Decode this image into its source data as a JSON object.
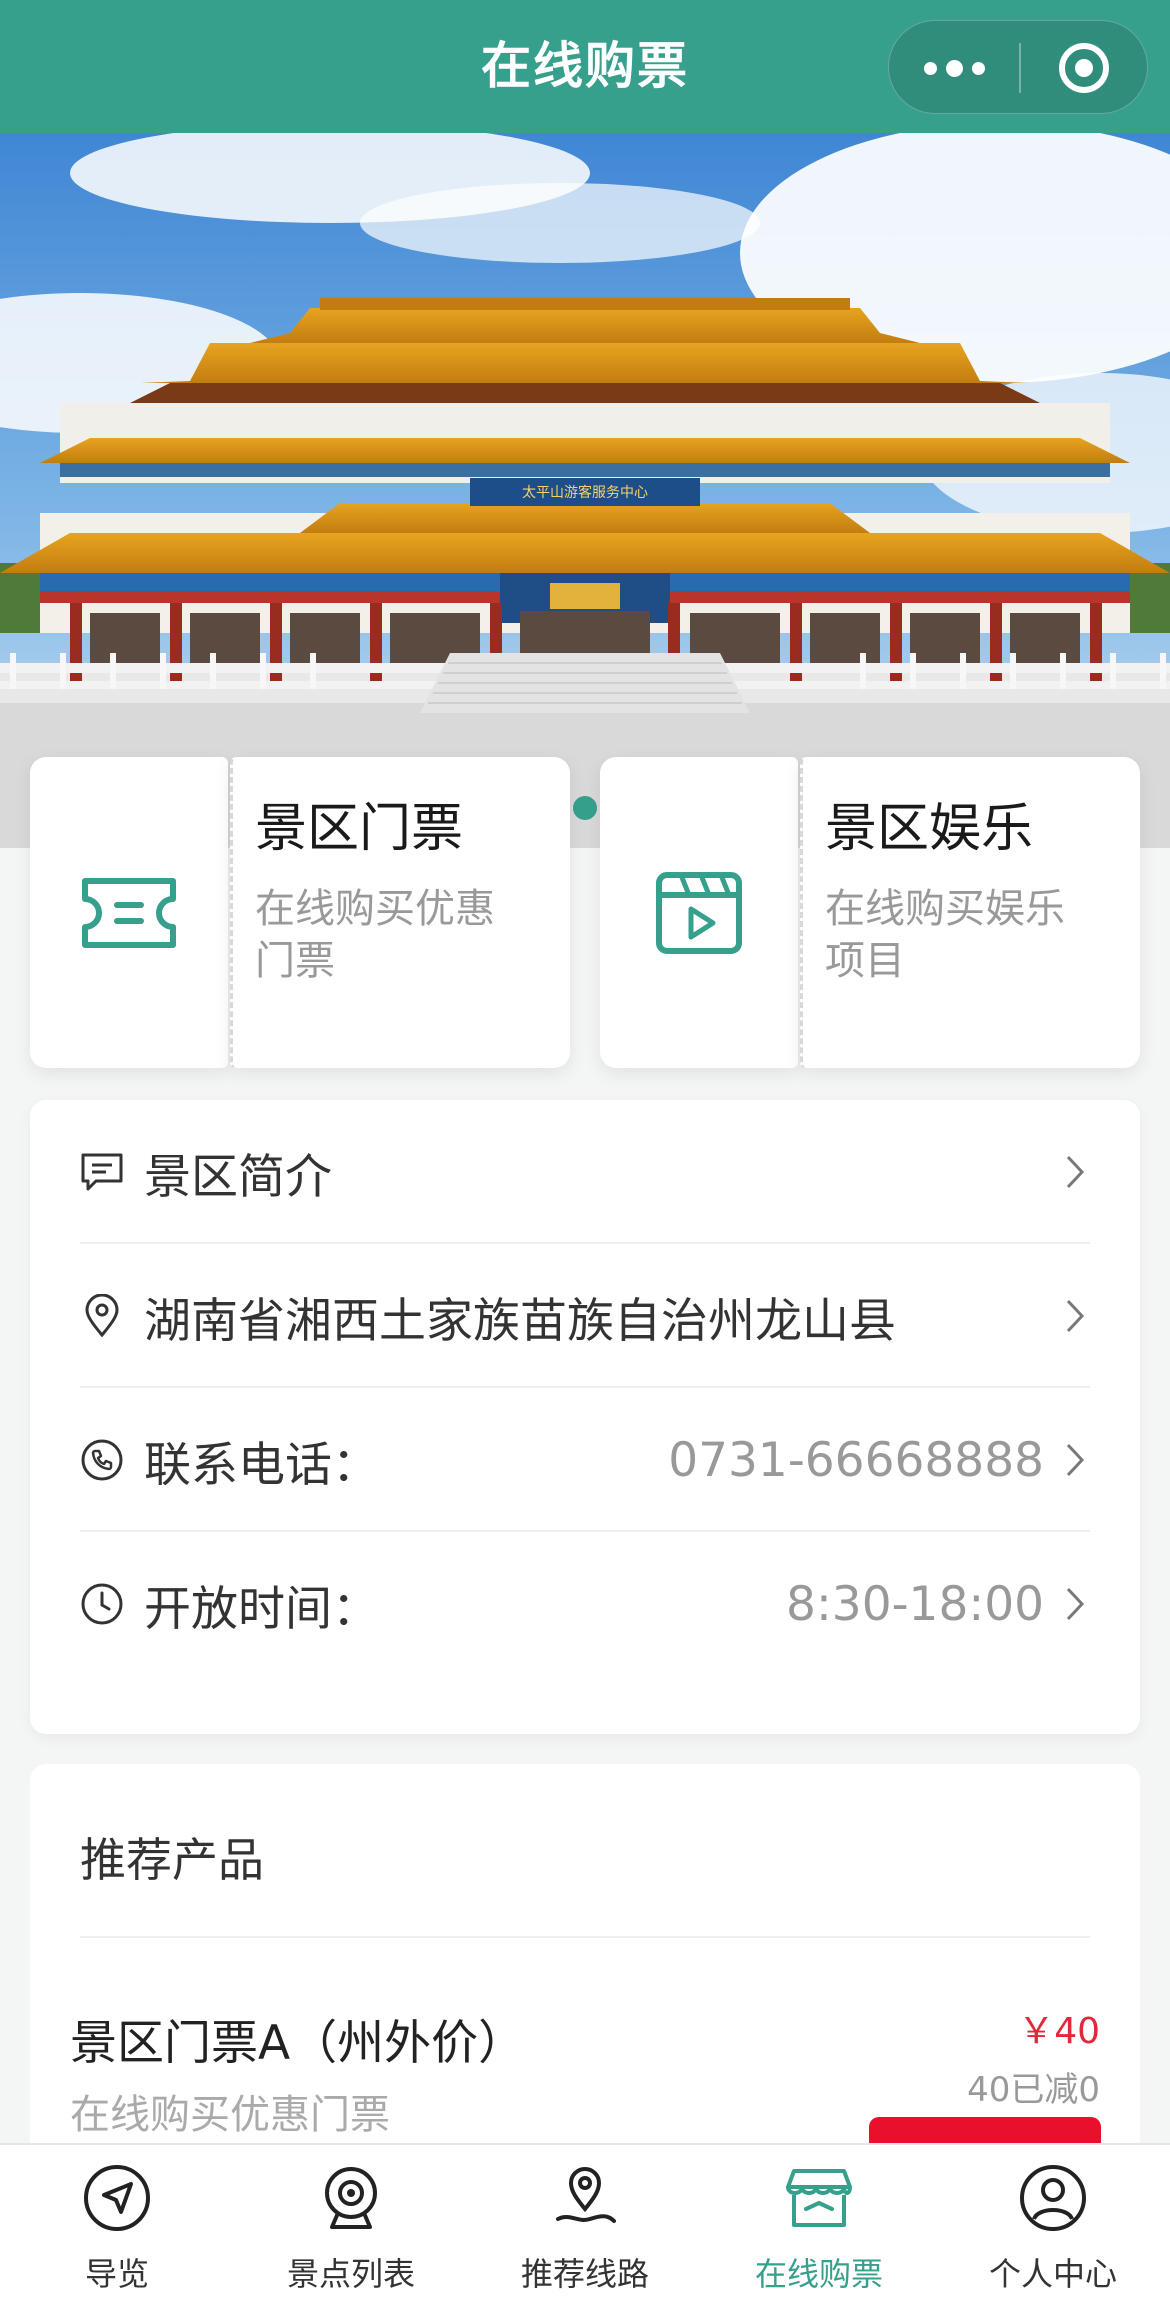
{
  "header": {
    "title": "在线购票"
  },
  "colors": {
    "primary": "#37a08d",
    "price": "#e0293a",
    "buy": "#e8102a"
  },
  "banner": {
    "sign_text": "太平山游客服务中心"
  },
  "ticket_cards": [
    {
      "title": "景区门票",
      "subtitle_line1": "在线购买优惠",
      "subtitle_line2": "门票",
      "icon": "ticket-icon"
    },
    {
      "title": "景区娱乐",
      "subtitle_line1": "在线购买娱乐",
      "subtitle_line2": "项目",
      "icon": "video-icon"
    }
  ],
  "info": {
    "intro_label": "景区简介",
    "address": "湖南省湘西土家族苗族自治州龙山县",
    "phone_label": "联系电话：",
    "phone_value": "0731-66668888",
    "hours_label": "开放时间：",
    "hours_value": "8:30-18:00"
  },
  "products": {
    "heading": "推荐产品",
    "items": [
      {
        "name": "景区门票A（州外价）",
        "subtitle": "在线购买优惠门票",
        "price": "￥40",
        "discount": "40已减0"
      }
    ]
  },
  "tabbar": {
    "items": [
      {
        "label": "导览",
        "icon": "navigation-icon"
      },
      {
        "label": "景点列表",
        "icon": "camera-icon"
      },
      {
        "label": "推荐线路",
        "icon": "route-pin-icon"
      },
      {
        "label": "在线购票",
        "icon": "store-icon",
        "active": true
      },
      {
        "label": "个人中心",
        "icon": "user-icon"
      }
    ]
  }
}
